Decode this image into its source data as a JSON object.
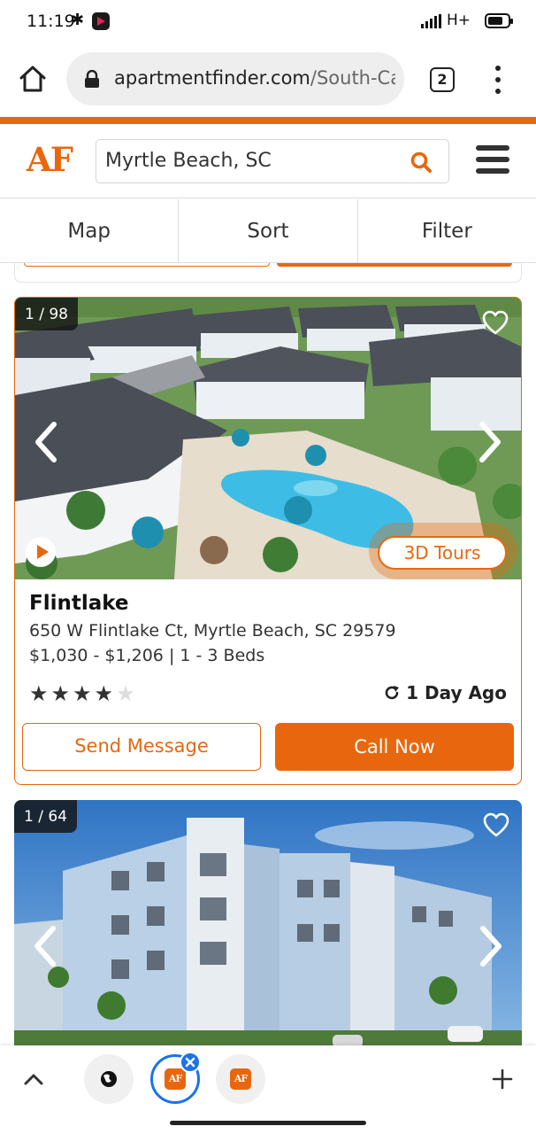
{
  "status_bar": {
    "time": "11:19",
    "network": "H+",
    "icons": [
      "bluetooth-icon",
      "app-notification-icon",
      "signal-icon",
      "battery-icon"
    ]
  },
  "browser": {
    "url_domain": "apartmentfinder.com",
    "url_path": "/South-Ca",
    "tab_count": "2"
  },
  "site": {
    "logo": "AF",
    "search_value": "Myrtle Beach, SC",
    "brand_color": "#e8670e"
  },
  "toolbar": {
    "map": "Map",
    "sort": "Sort",
    "filter": "Filter"
  },
  "listings": [
    {
      "photo_counter": "1 / 98",
      "tours_badge": "3D Tours",
      "name": "Flintlake",
      "address": "650 W Flintlake Ct, Myrtle Beach, SC 29579",
      "price_beds": "$1,030 - $1,206 | 1 - 3 Beds",
      "rating": 4,
      "rating_max": 5,
      "updated": "1 Day Ago",
      "send_message": "Send Message",
      "call_now": "Call Now"
    },
    {
      "photo_counter": "1 / 64"
    }
  ],
  "bottom_bar": {
    "tabs": [
      "globe-tab",
      "af-tab-active",
      "af-tab"
    ]
  }
}
